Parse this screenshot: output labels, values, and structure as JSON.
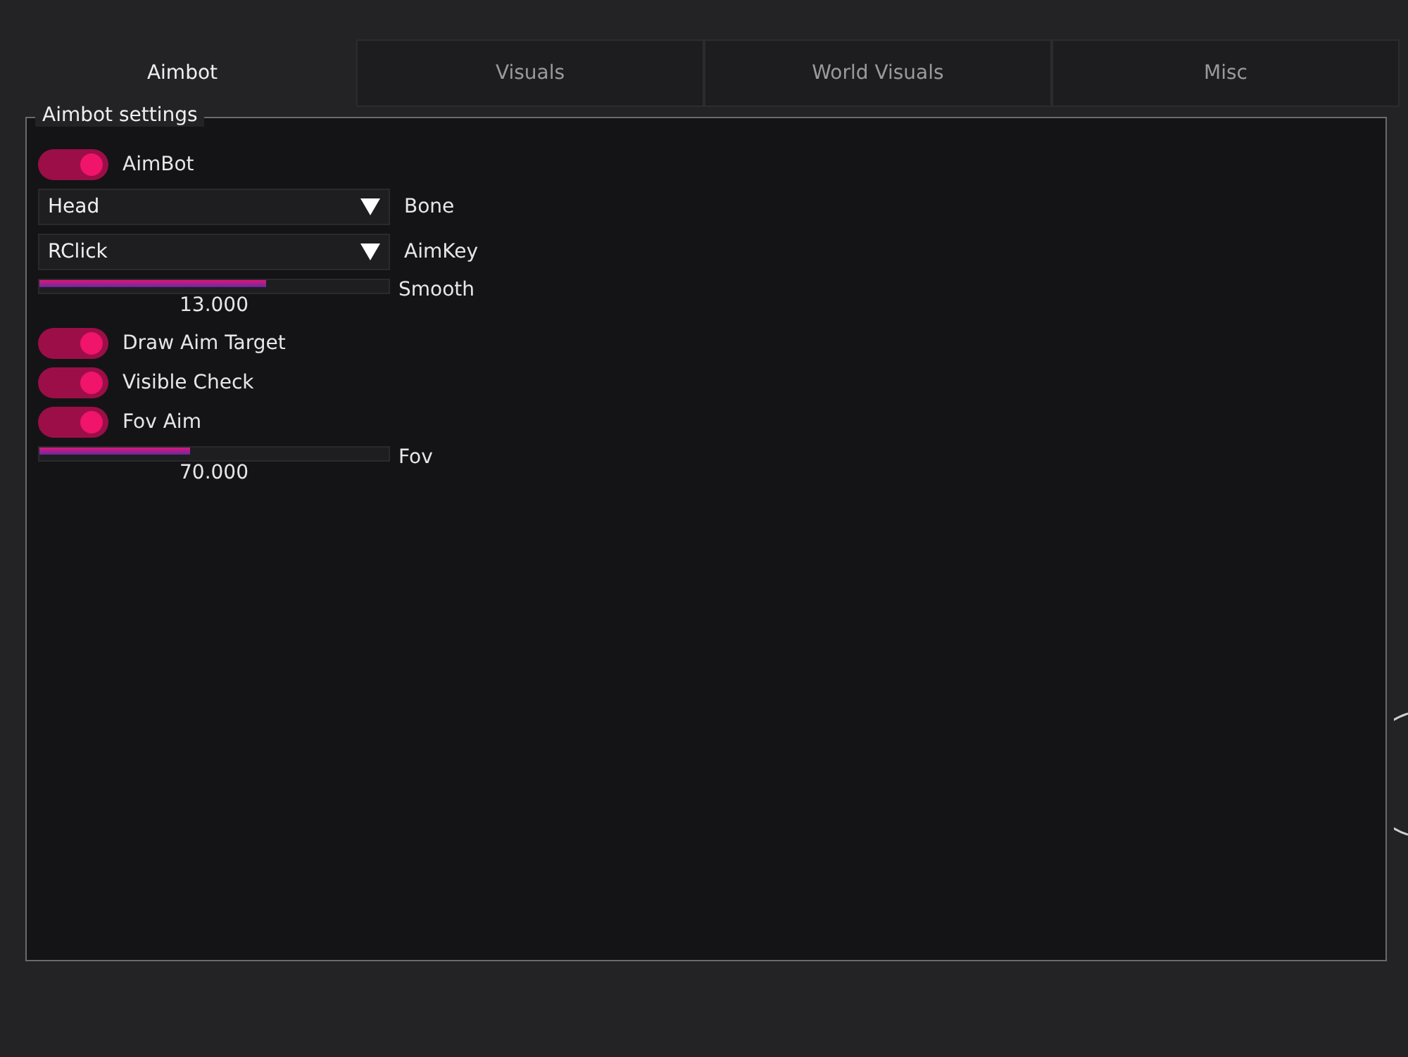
{
  "tabs": [
    {
      "label": "Aimbot",
      "selected": true
    },
    {
      "label": "Visuals",
      "selected": false
    },
    {
      "label": "World Visuals",
      "selected": false
    },
    {
      "label": "Misc",
      "selected": false
    }
  ],
  "group": {
    "title": "Aimbot settings"
  },
  "items": [
    {
      "kind": "toggle",
      "label": "AimBot",
      "on": true
    },
    {
      "kind": "combo",
      "value": "Head",
      "label": "Bone"
    },
    {
      "kind": "combo",
      "value": "RClick",
      "label": "AimKey"
    },
    {
      "kind": "slider",
      "level": 0.65,
      "reading": "13.000",
      "label": "Smooth"
    },
    {
      "kind": "toggle",
      "label": "Draw Aim Target",
      "on": true
    },
    {
      "kind": "toggle",
      "label": "Visible Check",
      "on": true
    },
    {
      "kind": "toggle",
      "label": "Fov Aim",
      "on": true
    },
    {
      "kind": "slider",
      "level": 0.43,
      "reading": "70.000",
      "label": "Fov"
    }
  ]
}
